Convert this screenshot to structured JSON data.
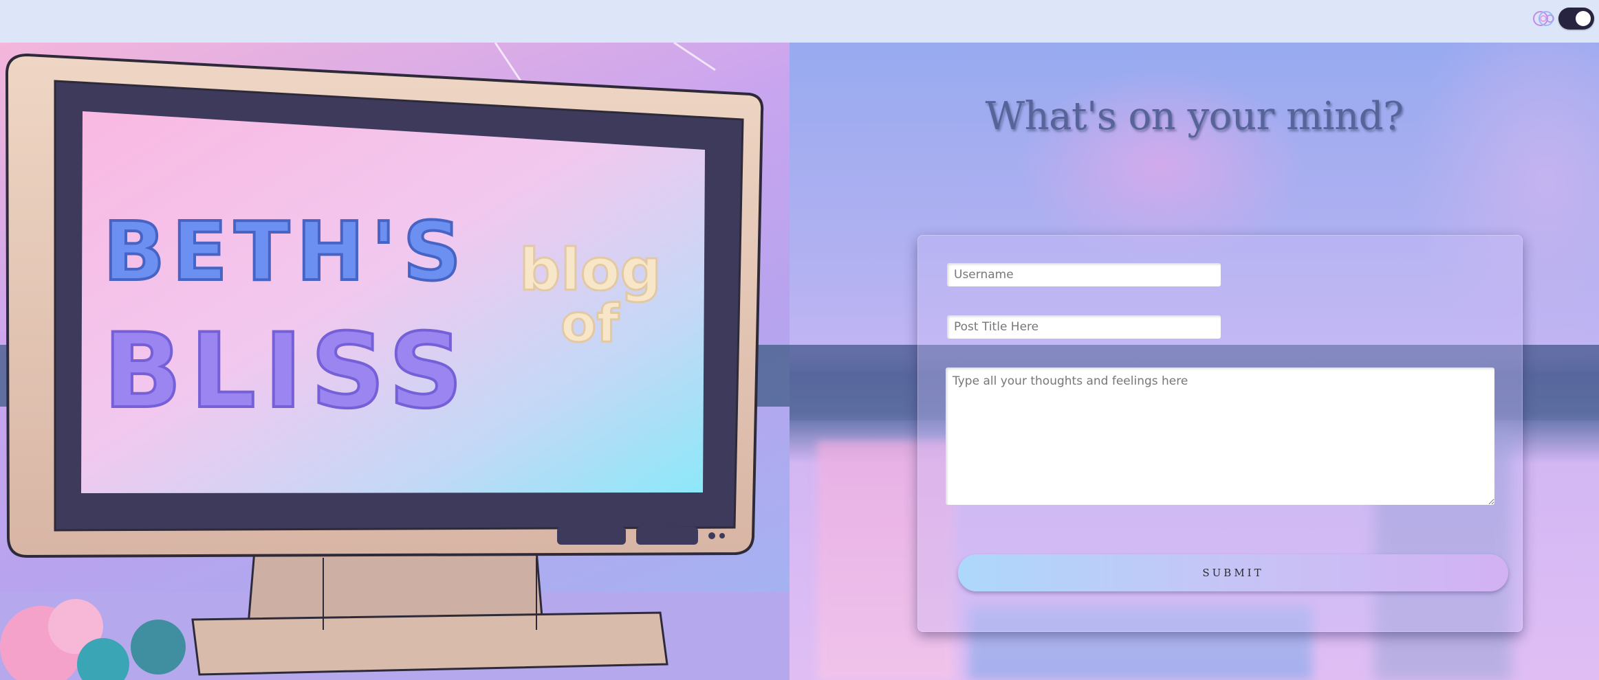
{
  "header": {
    "theme_icon": "palette-swirl-icon",
    "toggle": {
      "state": "on",
      "icon": "dark-mode-toggle"
    }
  },
  "hero": {
    "logo_line1": "BETH'S",
    "logo_word_blog": "blog",
    "logo_word_of": "of",
    "logo_line2": "BLISS",
    "colors": {
      "blue": "#6c8ff2",
      "purple": "#9b85f0",
      "cream": "#f7e6c7"
    }
  },
  "main": {
    "title": "What's on your mind?",
    "form": {
      "username_placeholder": "Username",
      "post_title_placeholder": "Post Title Here",
      "body_placeholder": "Type all your thoughts and feelings here",
      "submit_label": "SUBMIT"
    }
  }
}
